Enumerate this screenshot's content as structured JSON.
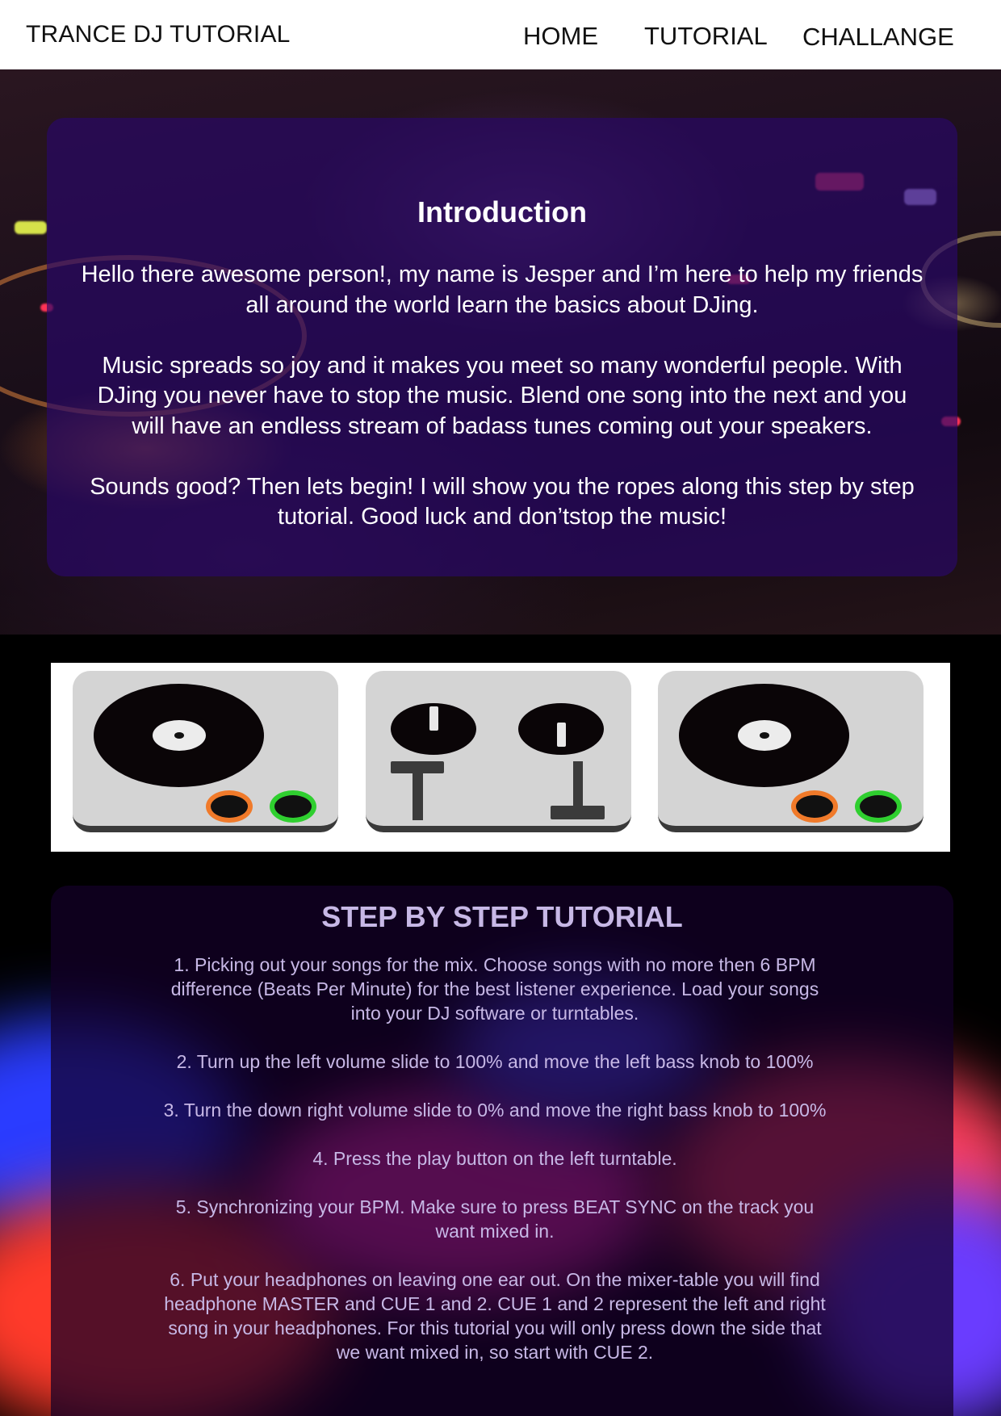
{
  "header": {
    "brand": "TRANCE DJ TUTORIAL",
    "nav": [
      {
        "label": "HOME"
      },
      {
        "label": "TUTORIAL"
      },
      {
        "label": "CHALLANGE"
      }
    ]
  },
  "intro": {
    "title": "Introduction",
    "paragraphs": [
      "Hello there awesome person!, my name is Jesper and I’m here to help my friends all around the world learn the basics about DJing.",
      "Music spreads so joy and it makes you meet so many wonderful people. With DJing you never have to stop the music. Blend one song into the next and you will have an endless stream of badass tunes coming out your speakers.",
      "Sounds good? Then lets begin! I will show you the ropes along this step by step tutorial. Good luck and don’tstop the music!"
    ]
  },
  "gear": {
    "icons": [
      "turntable-left-icon",
      "mixer-icon",
      "turntable-right-icon"
    ],
    "colors": {
      "panel": "#d4d4d4",
      "platter": "#0a0507",
      "cue_button": "#f07a2a",
      "play_button": "#2fcf2f"
    }
  },
  "tutorial": {
    "title": "STEP BY STEP TUTORIAL",
    "steps": [
      "1.  Picking out your songs for the mix. Choose songs with no more then 6 BPM difference (Beats Per Minute) for the best listener experience. Load your songs into your DJ software or turntables.",
      "2. Turn up the left volume slide to 100% and move the left bass knob to 100%",
      "3. Turn the down right volume slide to 0% and move the right bass knob to 100%",
      "4. Press the play button on the left turntable.",
      "5. Synchronizing your BPM. Make sure to press BEAT SYNC on the track you want mixed in.",
      "6.   Put your headphones on leaving one ear out. On the mixer-table you will find headphone MASTER and CUE 1 and 2.  CUE 1 and 2 represent the left and right song in your headphones. For this tutorial you will only press down the side that we want mixed in, so start with CUE 2."
    ]
  },
  "theme": {
    "intro_panel": "#2a0869",
    "tutorial_text": "#c7b8e6"
  }
}
